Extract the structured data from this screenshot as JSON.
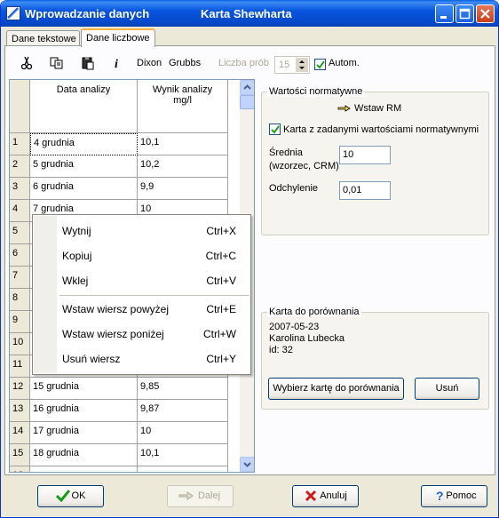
{
  "window": {
    "title_left": "Wprowadzanie danych",
    "title_center": "Karta Shewharta"
  },
  "tabs": [
    "Dane tekstowe",
    "Dane liczbowe"
  ],
  "toolbar": {
    "dixon": "Dixon",
    "grubbs": "Grubbs",
    "sample_count_label": "Liczba prób",
    "sample_count_value": "15",
    "auto_label": "Autom."
  },
  "grid": {
    "col1_header": "Data analizy",
    "col2_header_line1": "Wynik analizy",
    "col2_header_line2": "mg/l",
    "rows": [
      {
        "n": "1",
        "date": "4 grudnia",
        "val": "10,1"
      },
      {
        "n": "2",
        "date": "5 grudnia",
        "val": "10,2"
      },
      {
        "n": "3",
        "date": "6 grudnia",
        "val": "9,9"
      },
      {
        "n": "4",
        "date": "7 grudnia",
        "val": "10"
      },
      {
        "n": "5",
        "date": "8",
        "val": ""
      },
      {
        "n": "6",
        "date": "",
        "val": ""
      },
      {
        "n": "7",
        "date": "",
        "val": ""
      },
      {
        "n": "8",
        "date": "",
        "val": ""
      },
      {
        "n": "9",
        "date": "",
        "val": ""
      },
      {
        "n": "10",
        "date": "",
        "val": ""
      },
      {
        "n": "11",
        "date": "",
        "val": ""
      },
      {
        "n": "12",
        "date": "15 grudnia",
        "val": "9,85"
      },
      {
        "n": "13",
        "date": "16 grudnia",
        "val": "9,87"
      },
      {
        "n": "14",
        "date": "17 grudnia",
        "val": "10"
      },
      {
        "n": "15",
        "date": "18 grudnia",
        "val": "10,1"
      },
      {
        "n": "16",
        "date": "",
        "val": ""
      }
    ]
  },
  "normative": {
    "group_title": "Wartości normatywne",
    "insert_rm": "Wstaw RM",
    "checkbox_label": "Karta z zadanymi wartościami normatywnymi",
    "mean_label_line1": "Średnia",
    "mean_label_line2": "(wzorzec, CRM)",
    "mean_value": "10",
    "deviation_label": "Odchylenie",
    "deviation_value": "0,01"
  },
  "comparison": {
    "group_title": "Karta do porównania",
    "date": "2007-05-23",
    "author": "Karolina Lubecka",
    "id": "id: 32",
    "choose_button": "Wybierz kartę do porównania",
    "remove_button": "Usuń"
  },
  "context_menu": [
    {
      "label": "Wytnij",
      "shortcut": "Ctrl+X"
    },
    {
      "label": "Kopiuj",
      "shortcut": "Ctrl+C"
    },
    {
      "label": "Wklej",
      "shortcut": "Ctrl+V"
    },
    {
      "label": "Wstaw wiersz powyżej",
      "shortcut": "Ctrl+E"
    },
    {
      "label": "Wstaw wiersz poniżej",
      "shortcut": "Ctrl+W"
    },
    {
      "label": "Usuń wiersz",
      "shortcut": "Ctrl+Y"
    }
  ],
  "footer": {
    "ok": "OK",
    "next": "Dalej",
    "cancel": "Anuluj",
    "help": "Pomoc"
  }
}
